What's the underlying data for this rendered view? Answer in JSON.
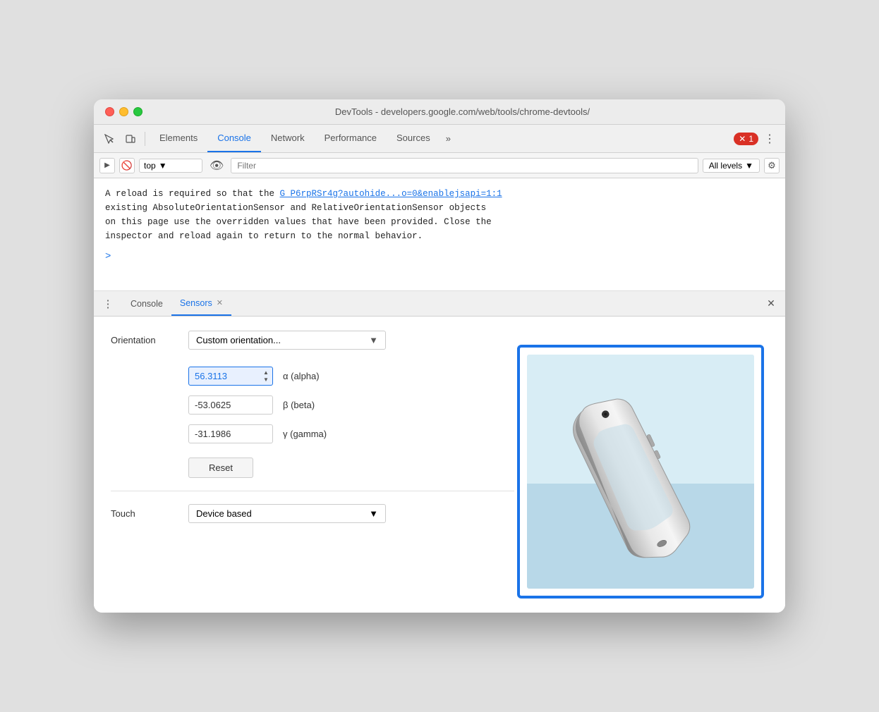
{
  "window": {
    "title": "DevTools - developers.google.com/web/tools/chrome-devtools/"
  },
  "toolbar": {
    "tabs": [
      {
        "id": "elements",
        "label": "Elements",
        "active": false
      },
      {
        "id": "console",
        "label": "Console",
        "active": true
      },
      {
        "id": "network",
        "label": "Network",
        "active": false
      },
      {
        "id": "performance",
        "label": "Performance",
        "active": false
      },
      {
        "id": "sources",
        "label": "Sources",
        "active": false
      }
    ],
    "more_label": "»",
    "error_count": "1",
    "kebab": "⋮"
  },
  "console_toolbar": {
    "context": "top",
    "filter_placeholder": "Filter",
    "levels": "All levels"
  },
  "console": {
    "message": "A reload is required so that the",
    "link_text": "G_P6rpRSr4g?autohide...o=0&enablejsapi=1:1",
    "message2": "existing AbsoluteOrientationSensor and RelativeOrientationSensor objects",
    "message3": "on this page use the overridden values that have been provided. Close the",
    "message4": "inspector and reload again to return to the normal behavior.",
    "prompt": ">"
  },
  "bottom_panel": {
    "kebab": "⋮",
    "tabs": [
      {
        "id": "console",
        "label": "Console",
        "active": false,
        "closeable": false
      },
      {
        "id": "sensors",
        "label": "Sensors",
        "active": true,
        "closeable": true
      }
    ],
    "close_icon": "✕"
  },
  "sensors": {
    "orientation_label": "Orientation",
    "orientation_value": "Custom orientation...",
    "alpha_value": "56.3113",
    "alpha_symbol": "α (alpha)",
    "beta_value": "-53.0625",
    "beta_symbol": "β (beta)",
    "gamma_value": "-31.1986",
    "gamma_symbol": "γ (gamma)",
    "reset_label": "Reset",
    "touch_label": "Touch",
    "touch_value": "Device based"
  }
}
